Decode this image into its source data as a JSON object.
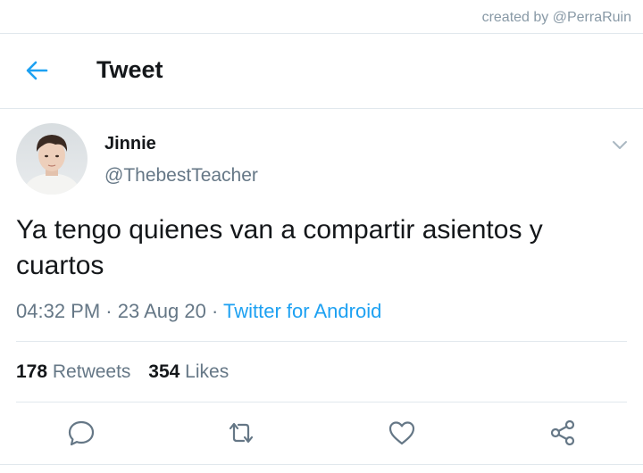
{
  "credit": "created by @PerraRuin",
  "header": {
    "title": "Tweet",
    "back_icon": "arrow-left-icon"
  },
  "tweet": {
    "author_name": "Jinnie",
    "author_handle": "@ThebestTeacher",
    "text": "Ya tengo quienes van a compartir asientos y cuartos",
    "time": "04:32 PM",
    "separator": "·",
    "date": "23 Aug 20",
    "source": "Twitter for Android",
    "menu_icon": "chevron-down-icon"
  },
  "stats": {
    "retweets_count": "178",
    "retweets_label": "Retweets",
    "likes_count": "354",
    "likes_label": "Likes"
  },
  "actions": [
    {
      "icon": "reply-icon"
    },
    {
      "icon": "retweet-icon"
    },
    {
      "icon": "like-icon"
    },
    {
      "icon": "share-icon"
    }
  ],
  "colors": {
    "accent": "#1da1f2",
    "text": "#14171a",
    "muted": "#657786",
    "divider": "#e1e8ed"
  }
}
